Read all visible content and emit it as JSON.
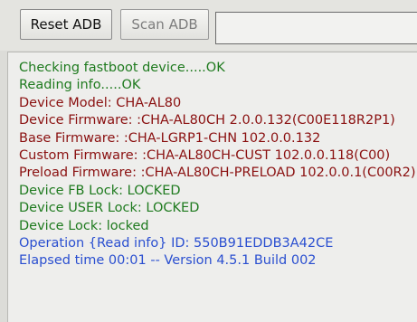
{
  "toolbar": {
    "reset_label": "Reset ADB",
    "scan_label": "Scan ADB",
    "field_value": ""
  },
  "log": [
    {
      "text": "Checking fastboot device.....OK",
      "color": "#1e7a1e"
    },
    {
      "text": "Reading info.....OK",
      "color": "#1e7a1e"
    },
    {
      "text": "Device Model: CHA-AL80",
      "color": "#8a1010"
    },
    {
      "text": "Device Firmware: :CHA-AL80CH 2.0.0.132(C00E118R2P1)",
      "color": "#8a1010"
    },
    {
      "text": "Base Firmware: :CHA-LGRP1-CHN 102.0.0.132",
      "color": "#8a1010"
    },
    {
      "text": "Custom Firmware: :CHA-AL80CH-CUST 102.0.0.118(C00)",
      "color": "#8a1010"
    },
    {
      "text": "Preload Firmware: :CHA-AL80CH-PRELOAD 102.0.0.1(C00R2)",
      "color": "#8a1010"
    },
    {
      "text": "Device FB Lock: LOCKED",
      "color": "#1e7a1e"
    },
    {
      "text": "Device USER Lock: LOCKED",
      "color": "#1e7a1e"
    },
    {
      "text": "Device Lock: locked",
      "color": "#1e7a1e"
    },
    {
      "text": "Operation {Read info} ID: 550B91EDDB3A42CE",
      "color": "#2a4fd0"
    },
    {
      "text": "Elapsed time 00:01 -- Version 4.5.1 Build 002",
      "color": "#2a4fd0"
    }
  ]
}
